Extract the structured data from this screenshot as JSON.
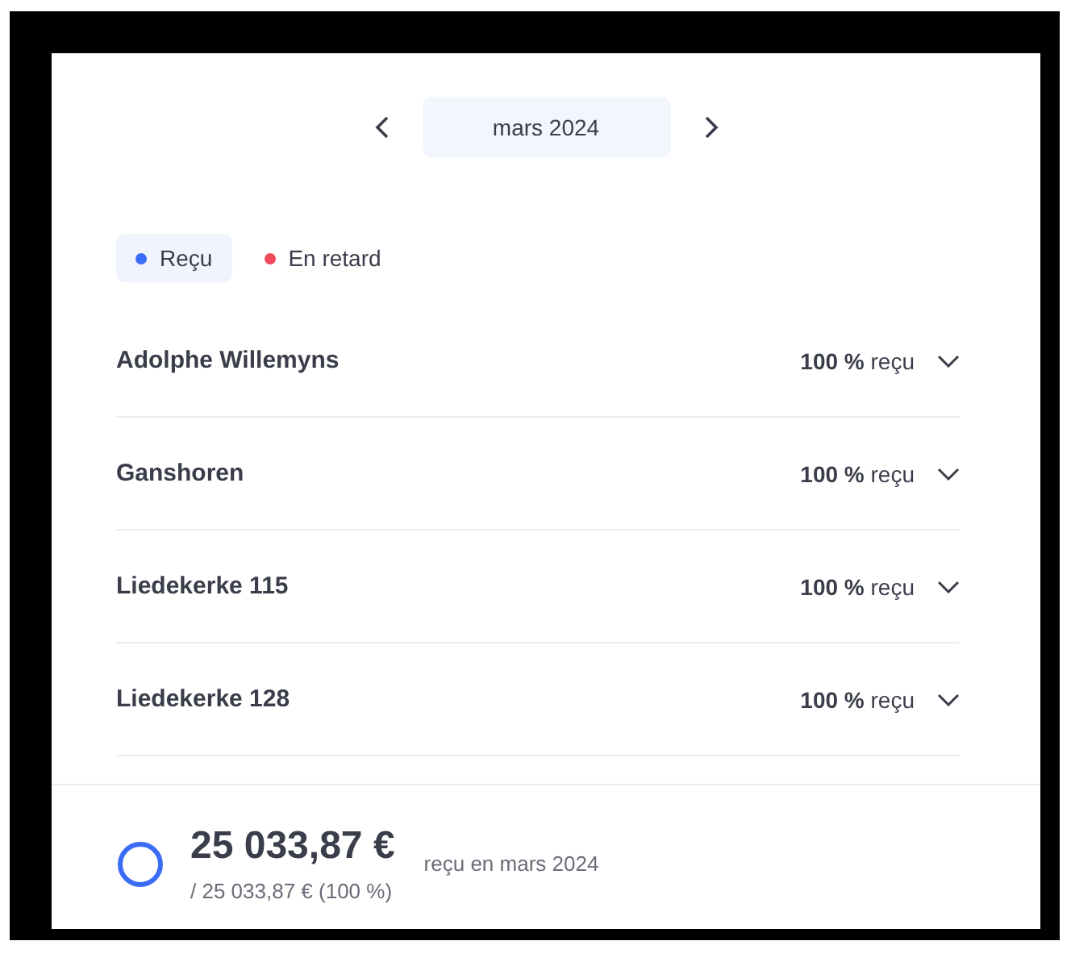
{
  "month_nav": {
    "label": "mars 2024"
  },
  "legend": [
    {
      "label": "Reçu",
      "color": "#3b6cf6",
      "selected": true
    },
    {
      "label": "En retard",
      "color": "#ef4a5a",
      "selected": false
    }
  ],
  "rows": [
    {
      "name": "Adolphe Willemyns",
      "status": "**100 %** reçu",
      "expanded": false
    },
    {
      "name": "Ganshoren",
      "status": "**100 %** reçu",
      "expanded": false
    },
    {
      "name": "Liedekerke 115",
      "status": "**100 %** reçu",
      "expanded": false
    },
    {
      "name": "Liedekerke 128",
      "status": "**100 %** reçu",
      "expanded": false
    }
  ],
  "summary": {
    "amount": "25 033,87 €",
    "total": "/ 25 033,87 € (100 %)",
    "caption": "reçu en mars 2024",
    "level": 0
  }
}
